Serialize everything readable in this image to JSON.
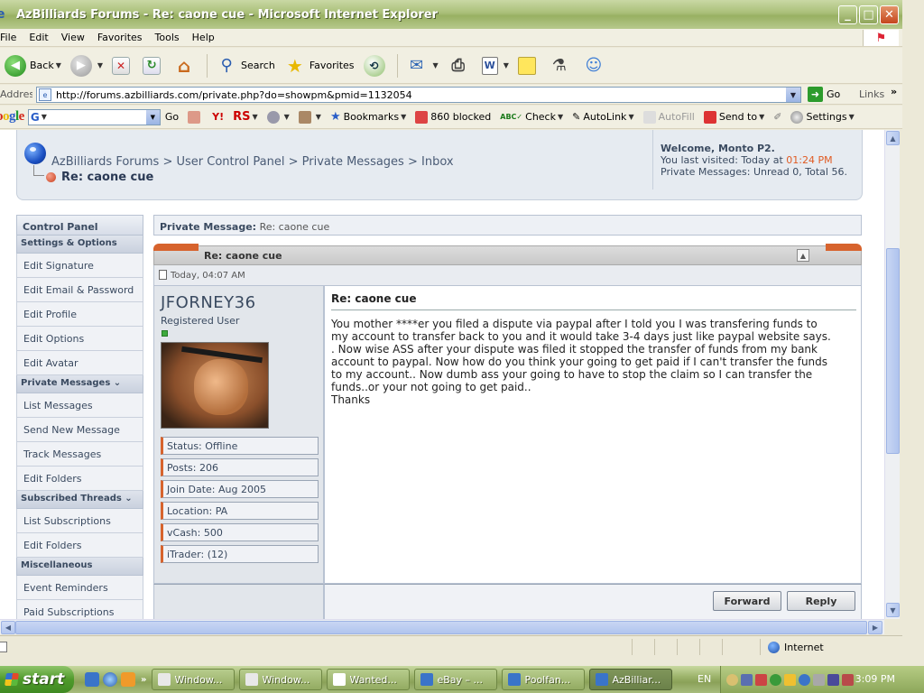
{
  "window": {
    "title": "AzBilliards Forums - Re: caone cue - Microsoft Internet Explorer",
    "min": "_",
    "max": "□",
    "close": "✕"
  },
  "menu": [
    "File",
    "Edit",
    "View",
    "Favorites",
    "Tools",
    "Help"
  ],
  "toolbar": {
    "back": "Back",
    "search": "Search",
    "favorites": "Favorites"
  },
  "address": {
    "label": "Address",
    "url": "http://forums.azbilliards.com/private.php?do=showpm&pmid=1132054",
    "go": "Go",
    "links": "Links"
  },
  "google": {
    "go": "Go",
    "rs": "RS",
    "bookmarks": "Bookmarks",
    "blocked": "860 blocked",
    "check": "Check",
    "autolink": "AutoLink",
    "autofill": "AutoFill",
    "sendto": "Send to",
    "settings": "Settings"
  },
  "forum": {
    "breadcrumb": [
      "AzBilliards Forums",
      "User Control Panel",
      "Private Messages",
      "Inbox"
    ],
    "page_title": "Re: caone cue",
    "welcome": {
      "hello": "Welcome, Monto P2.",
      "last_visited_prefix": "You last visited: Today at ",
      "last_visited_time": "01:24 PM",
      "pm_status": "Private Messages: Unread 0, Total 56."
    }
  },
  "sidebar": {
    "header": "Control Panel",
    "sections": [
      {
        "title": "Settings & Options",
        "items": [
          "Edit Signature",
          "Edit Email & Password",
          "Edit Profile",
          "Edit Options",
          "Edit Avatar"
        ]
      },
      {
        "title": "Private Messages",
        "items": [
          "List Messages",
          "Send New Message",
          "Track Messages",
          "Edit Folders"
        ]
      },
      {
        "title": "Subscribed Threads",
        "items": [
          "List Subscriptions",
          "Edit Folders"
        ]
      },
      {
        "title": "Miscellaneous",
        "items": [
          "Event Reminders",
          "Paid Subscriptions"
        ]
      }
    ]
  },
  "message": {
    "bar_label": "Private Message:",
    "bar_title": "Re: caone cue",
    "header_title": "Re: caone cue",
    "date": "Today, 04:07 AM",
    "user": {
      "name": "JFORNEY36",
      "role": "Registered User",
      "stats": [
        "Status: Offline",
        "Posts: 206",
        "Join Date: Aug 2005",
        "Location: PA",
        "vCash: 500",
        "iTrader: (12)"
      ]
    },
    "title": "Re: caone cue",
    "body": "You mother ****er you filed a dispute via paypal after I told you I was transfering funds to\nmy account to transfer back to you and it would take 3-4 days just like paypal website says.\n. Now wise ASS after your dispute was filed it stopped the transfer of funds from my bank\naccount to paypal. Now how do you think your going to get paid if I can't transfer the funds\nto my account.. Now dumb ass your going to have to stop the claim so I can transfer the\nfunds..or your not going to get paid..\nThanks",
    "forward": "Forward",
    "reply": "Reply"
  },
  "status": {
    "zone": "Internet"
  },
  "taskbar": {
    "start": "start",
    "tasks": [
      "Window...",
      "Window...",
      "Wanted...",
      "eBay – ...",
      "Poolfan...",
      "AzBilliar..."
    ],
    "lang": "EN",
    "clock": "3:09 PM"
  }
}
